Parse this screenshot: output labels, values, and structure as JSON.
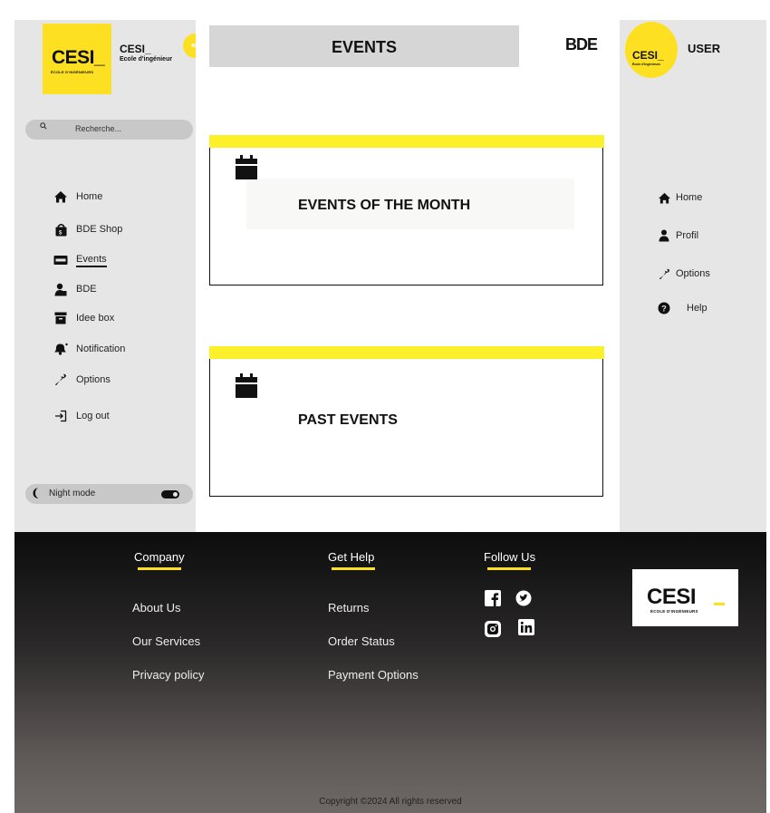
{
  "brand": {
    "logo_text": "CESI_",
    "logo_sub": "ÉCOLE D'INGÉNIEURS",
    "title": "CESI_",
    "subtitle": "Ecole d'ingénieur"
  },
  "header": {
    "page_title": "EVENTS",
    "bde_logo": "BDE",
    "collapse_icon": "share-icon"
  },
  "search": {
    "placeholder": "Recherche..."
  },
  "sidebar": {
    "items": [
      {
        "label": "Home",
        "icon": "home-icon"
      },
      {
        "label": "BDE Shop",
        "icon": "shopping-bag-icon"
      },
      {
        "label": "Events",
        "icon": "ticket-icon",
        "active": true
      },
      {
        "label": "BDE",
        "icon": "users-icon"
      },
      {
        "label": "Idee box",
        "icon": "archive-box-icon"
      },
      {
        "label": "Notification",
        "icon": "bell-icon"
      },
      {
        "label": "Options",
        "icon": "wrench-icon"
      },
      {
        "label": "Log out",
        "icon": "log-out-icon"
      }
    ],
    "night_mode": {
      "label": "Night mode",
      "on": false
    }
  },
  "cards": [
    {
      "title": "EVENTS OF THE MONTH",
      "icon": "calendar-icon"
    },
    {
      "title": "PAST EVENTS",
      "icon": "calendar-icon"
    }
  ],
  "user_panel": {
    "avatar_text": "CESI_",
    "avatar_sub": "École d'ingénieurs",
    "username": "USER",
    "items": [
      {
        "label": "Home",
        "icon": "home-icon"
      },
      {
        "label": "Profil",
        "icon": "user-icon"
      },
      {
        "label": "Options",
        "icon": "wrench-icon"
      },
      {
        "label": "Help",
        "icon": "question-circle-icon"
      }
    ]
  },
  "footer": {
    "columns": [
      {
        "heading": "Company",
        "links": [
          "About Us",
          "Our Services",
          "Privacy policy"
        ]
      },
      {
        "heading": "Get Help",
        "links": [
          "Returns",
          "Order Status",
          "Payment Options"
        ]
      },
      {
        "heading": "Follow Us",
        "links": []
      }
    ],
    "social_icons": [
      "facebook-icon",
      "twitter-icon",
      "instagram-icon",
      "linkedin-icon"
    ],
    "logo_text": "CESI",
    "logo_sub": "ÉCOLE D'INGÉNIEURS",
    "copyright": "Copyright ©2024 All rights reserved"
  },
  "colors": {
    "accent": "#fde021",
    "card_bar": "#fbf02a",
    "sidebar_bg": "#e6e6e6",
    "footer_dark": "#0d0d0d"
  }
}
